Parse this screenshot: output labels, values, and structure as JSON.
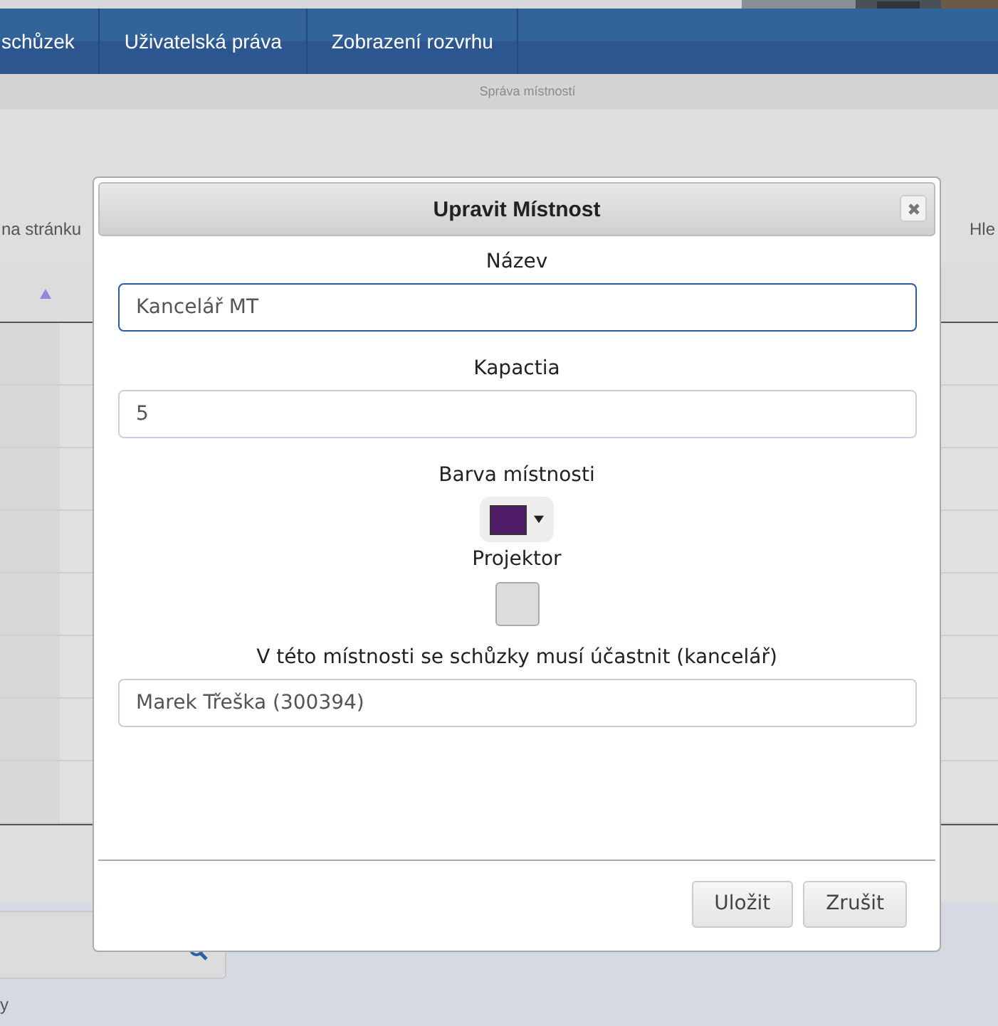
{
  "nav": {
    "items": [
      {
        "label": "schůzek",
        "selected": false
      },
      {
        "label": "Uživatelská práva",
        "selected": false
      },
      {
        "label": "Zobrazení rozvrhu",
        "selected": false
      }
    ]
  },
  "subtitle": "Správa místností",
  "toolbar": {
    "page_size_label": "na stránku",
    "search_label": "Hle"
  },
  "table": {
    "columns": [
      {
        "sort_ascending": true
      }
    ]
  },
  "footer": {
    "text": "y"
  },
  "dialog": {
    "title": "Upravit Místnost",
    "fields": [
      {
        "kind": "text",
        "label": "Název",
        "value": "Kancelář MT",
        "focused": true
      },
      {
        "kind": "text",
        "label": "Kapactia",
        "value": "5",
        "focused": false
      },
      {
        "kind": "color",
        "label": "Barva místnosti",
        "color": "#4f1a66"
      },
      {
        "kind": "checkbox",
        "label": "Projektor",
        "checked": false
      },
      {
        "kind": "text",
        "label": "V této místnosti se schůzky musí účastnit (kancelář)",
        "value": "Marek Třeška (300394)",
        "focused": false
      }
    ],
    "buttons": [
      "Uložit",
      "Zrušit"
    ]
  }
}
